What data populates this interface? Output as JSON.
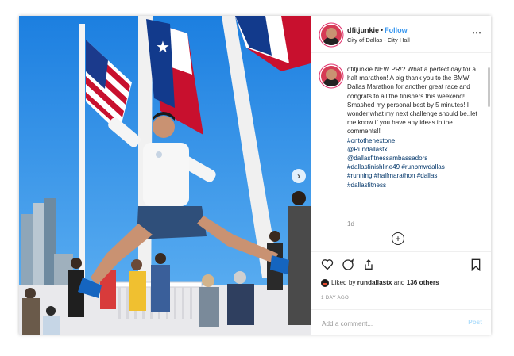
{
  "post": {
    "username": "dfitjunkie",
    "separator": "•",
    "follow_label": "Follow",
    "location": "City of Dallas - City Hall",
    "more_icon": "⋯"
  },
  "caption": {
    "username": "dfitjunkie",
    "text": "NEW PR!? What a perfect day for a half marathon! A big thank you to the BMW Dallas Marathon for another great race and congrats to all the finishers this weekend! Smashed my personal best by 5 minutes! I wonder what my next challenge should be..let me know if you have any ideas in the comments!!",
    "hashtags": [
      "#ontothenextone",
      "@Rundallastx",
      "@dallasfitnessambassadors",
      "#dallasfinishline49 #runbmwdallas",
      "#running #halfmarathon #dallas",
      "#dallasfitness"
    ],
    "time_ago": "1d",
    "load_more_icon": "+"
  },
  "likes": {
    "prefix": "Liked by",
    "user": "rundallastx",
    "conj": "and",
    "others": "136 others"
  },
  "date": "1 DAY AGO",
  "comment": {
    "placeholder": "Add a comment...",
    "post_label": "Post"
  },
  "carousel": {
    "next_icon": "›"
  },
  "colors": {
    "follow": "#3897f0",
    "sky": "#2b8be0",
    "hashtag": "#003569"
  },
  "icons": [
    "heart-icon",
    "comment-icon",
    "share-icon",
    "bookmark-icon"
  ]
}
